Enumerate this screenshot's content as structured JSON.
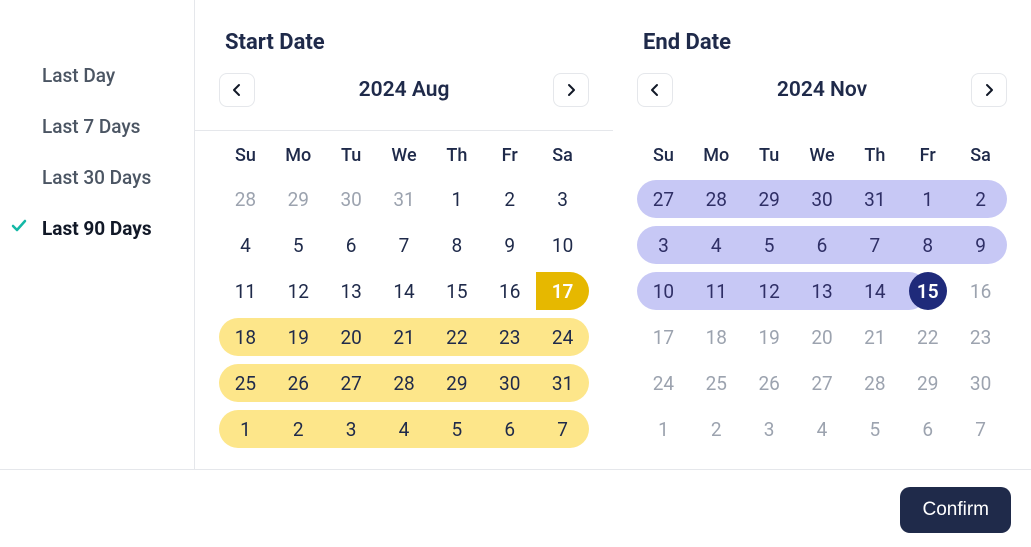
{
  "presets": [
    {
      "label": "Last Day",
      "active": false
    },
    {
      "label": "Last 7 Days",
      "active": false
    },
    {
      "label": "Last 30 Days",
      "active": false
    },
    {
      "label": "Last 90 Days",
      "active": true
    }
  ],
  "start": {
    "title": "Start Date",
    "month_label": "2024  Aug",
    "dow": [
      "Su",
      "Mo",
      "Tu",
      "We",
      "Th",
      "Fr",
      "Sa"
    ],
    "days": [
      {
        "n": 28,
        "o": true
      },
      {
        "n": 29,
        "o": true
      },
      {
        "n": 30,
        "o": true
      },
      {
        "n": 31,
        "o": true
      },
      {
        "n": 1
      },
      {
        "n": 2
      },
      {
        "n": 3
      },
      {
        "n": 4
      },
      {
        "n": 5
      },
      {
        "n": 6
      },
      {
        "n": 7
      },
      {
        "n": 8
      },
      {
        "n": 9
      },
      {
        "n": 10
      },
      {
        "n": 11
      },
      {
        "n": 12
      },
      {
        "n": 13
      },
      {
        "n": 14
      },
      {
        "n": 15
      },
      {
        "n": 16
      },
      {
        "n": 17,
        "sel": true
      },
      {
        "n": 18,
        "r": true,
        "first": true
      },
      {
        "n": 19,
        "r": true
      },
      {
        "n": 20,
        "r": true
      },
      {
        "n": 21,
        "r": true
      },
      {
        "n": 22,
        "r": true
      },
      {
        "n": 23,
        "r": true
      },
      {
        "n": 24,
        "r": true,
        "last": true
      },
      {
        "n": 25,
        "r": true,
        "first": true
      },
      {
        "n": 26,
        "r": true
      },
      {
        "n": 27,
        "r": true
      },
      {
        "n": 28,
        "r": true
      },
      {
        "n": 29,
        "r": true
      },
      {
        "n": 30,
        "r": true
      },
      {
        "n": 31,
        "r": true,
        "last": true
      },
      {
        "n": 1,
        "r": true,
        "first": true
      },
      {
        "n": 2,
        "r": true
      },
      {
        "n": 3,
        "r": true
      },
      {
        "n": 4,
        "r": true
      },
      {
        "n": 5,
        "r": true
      },
      {
        "n": 6,
        "r": true
      },
      {
        "n": 7,
        "r": true,
        "last": true
      }
    ]
  },
  "end": {
    "title": "End Date",
    "month_label": "2024  Nov",
    "dow": [
      "Su",
      "Mo",
      "Tu",
      "We",
      "Th",
      "Fr",
      "Sa"
    ],
    "days": [
      {
        "n": 27,
        "r": true,
        "first": true
      },
      {
        "n": 28,
        "r": true
      },
      {
        "n": 29,
        "r": true
      },
      {
        "n": 30,
        "r": true
      },
      {
        "n": 31,
        "r": true
      },
      {
        "n": 1,
        "r": true
      },
      {
        "n": 2,
        "r": true,
        "last": true
      },
      {
        "n": 3,
        "r": true,
        "first": true
      },
      {
        "n": 4,
        "r": true
      },
      {
        "n": 5,
        "r": true
      },
      {
        "n": 6,
        "r": true
      },
      {
        "n": 7,
        "r": true
      },
      {
        "n": 8,
        "r": true
      },
      {
        "n": 9,
        "r": true,
        "last": true
      },
      {
        "n": 10,
        "r": true,
        "first": true
      },
      {
        "n": 11,
        "r": true
      },
      {
        "n": 12,
        "r": true
      },
      {
        "n": 13,
        "r": true
      },
      {
        "n": 14,
        "r": true
      },
      {
        "n": 15,
        "sel": true
      },
      {
        "n": 16,
        "o": true
      },
      {
        "n": 17,
        "o": true
      },
      {
        "n": 18,
        "o": true
      },
      {
        "n": 19,
        "o": true
      },
      {
        "n": 20,
        "o": true
      },
      {
        "n": 21,
        "o": true
      },
      {
        "n": 22,
        "o": true
      },
      {
        "n": 23,
        "o": true
      },
      {
        "n": 24,
        "o": true
      },
      {
        "n": 25,
        "o": true
      },
      {
        "n": 26,
        "o": true
      },
      {
        "n": 27,
        "o": true
      },
      {
        "n": 28,
        "o": true
      },
      {
        "n": 29,
        "o": true
      },
      {
        "n": 30,
        "o": true
      },
      {
        "n": 1,
        "o": true
      },
      {
        "n": 2,
        "o": true
      },
      {
        "n": 3,
        "o": true
      },
      {
        "n": 4,
        "o": true
      },
      {
        "n": 5,
        "o": true
      },
      {
        "n": 6,
        "o": true
      },
      {
        "n": 7,
        "o": true
      }
    ]
  },
  "confirm_label": "Confirm",
  "colors": {
    "start_range": "#fde68a",
    "start_selected": "#e6b800",
    "end_range": "#c7c8f5",
    "end_selected": "#1f2a7a",
    "accent_check": "#14b8a6",
    "primary_button": "#1f2a4a"
  }
}
